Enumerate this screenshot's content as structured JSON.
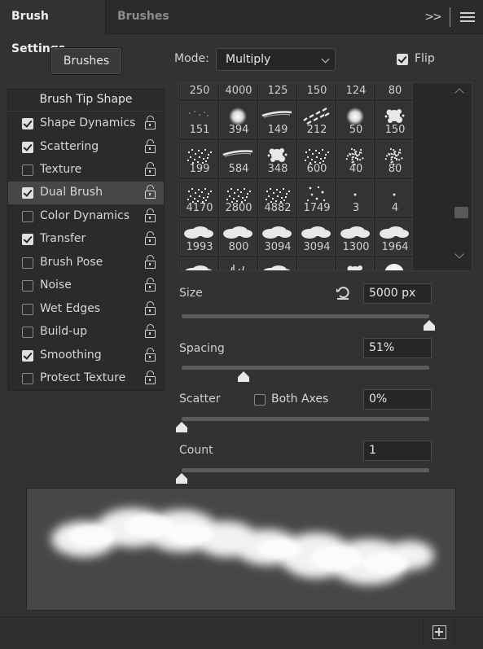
{
  "tabs": [
    {
      "label": "Brush Settings",
      "active": true
    },
    {
      "label": "Brushes",
      "active": false
    }
  ],
  "header": {
    "expand_glyph": ">>",
    "menu_icon": "hamburger-menu-icon"
  },
  "brushes_button": "Brushes",
  "mode": {
    "label": "Mode:",
    "value": "Multiply"
  },
  "flip": {
    "label": "Flip",
    "checked": true
  },
  "brush_tip_shape": "Brush Tip Shape",
  "options": [
    {
      "label": "Shape Dynamics",
      "checked": true,
      "selected": false
    },
    {
      "label": "Scattering",
      "checked": true,
      "selected": false
    },
    {
      "label": "Texture",
      "checked": false,
      "selected": false
    },
    {
      "label": "Dual Brush",
      "checked": true,
      "selected": true
    },
    {
      "label": "Color Dynamics",
      "checked": false,
      "selected": false
    },
    {
      "label": "Transfer",
      "checked": true,
      "selected": false
    },
    {
      "label": "Brush Pose",
      "checked": false,
      "selected": false
    },
    {
      "label": "Noise",
      "checked": false,
      "selected": false
    },
    {
      "label": "Wet Edges",
      "checked": false,
      "selected": false
    },
    {
      "label": "Build-up",
      "checked": false,
      "selected": false
    },
    {
      "label": "Smoothing",
      "checked": true,
      "selected": false
    },
    {
      "label": "Protect Texture",
      "checked": false,
      "selected": false
    }
  ],
  "presets": [
    {
      "size": "250",
      "thumb": "none"
    },
    {
      "size": "4000",
      "thumb": "none"
    },
    {
      "size": "125",
      "thumb": "none"
    },
    {
      "size": "150",
      "thumb": "none"
    },
    {
      "size": "124",
      "thumb": "none"
    },
    {
      "size": "80",
      "thumb": "none"
    },
    {
      "size": "151",
      "thumb": "faint"
    },
    {
      "size": "394",
      "thumb": "soft-round"
    },
    {
      "size": "149",
      "thumb": "streak"
    },
    {
      "size": "212",
      "thumb": "dashes"
    },
    {
      "size": "50",
      "thumb": "soft-round"
    },
    {
      "size": "150",
      "thumb": "splat"
    },
    {
      "size": "199",
      "thumb": "speckle"
    },
    {
      "size": "584",
      "thumb": "streak"
    },
    {
      "size": "348",
      "thumb": "splat"
    },
    {
      "size": "600",
      "thumb": "speckle"
    },
    {
      "size": "40",
      "thumb": "dotted-ball"
    },
    {
      "size": "80",
      "thumb": "dotted-ball"
    },
    {
      "size": "4170",
      "thumb": "speckle"
    },
    {
      "size": "2800",
      "thumb": "speckle"
    },
    {
      "size": "4882",
      "thumb": "speckle"
    },
    {
      "size": "1749",
      "thumb": "dots"
    },
    {
      "size": "3",
      "thumb": "dot"
    },
    {
      "size": "4",
      "thumb": "dot"
    },
    {
      "size": "1993",
      "thumb": "cloud"
    },
    {
      "size": "800",
      "thumb": "cloud"
    },
    {
      "size": "3094",
      "thumb": "cloud"
    },
    {
      "size": "3094",
      "thumb": "cloud"
    },
    {
      "size": "1300",
      "thumb": "cloud"
    },
    {
      "size": "1964",
      "thumb": "cloud"
    },
    {
      "size": "",
      "thumb": "cloud"
    },
    {
      "size": "",
      "thumb": "grass"
    },
    {
      "size": "",
      "thumb": "cloud"
    },
    {
      "size": "",
      "thumb": "dot"
    },
    {
      "size": "",
      "thumb": "splat"
    },
    {
      "size": "",
      "thumb": "hard-round"
    }
  ],
  "size": {
    "label": "Size",
    "value": "5000 px",
    "level": 1.0,
    "reset_icon": "reset-icon"
  },
  "spacing": {
    "label": "Spacing",
    "value": "51%",
    "level": 0.25
  },
  "scatter": {
    "label": "Scatter",
    "both_axes_label": "Both Axes",
    "both_axes_checked": false,
    "value": "0%",
    "level": 0.0
  },
  "count": {
    "label": "Count",
    "value": "1",
    "level": 0.0
  },
  "footer": {
    "new_icon": "create-new-brush-icon"
  }
}
